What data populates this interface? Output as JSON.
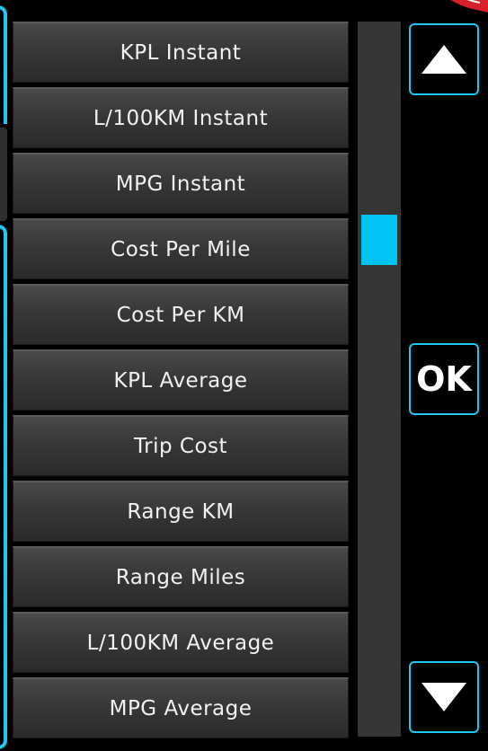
{
  "list": {
    "items": [
      {
        "label": "KPL Instant"
      },
      {
        "label": "L/100KM Instant"
      },
      {
        "label": "MPG Instant"
      },
      {
        "label": "Cost Per Mile"
      },
      {
        "label": "Cost Per KM"
      },
      {
        "label": "KPL Average"
      },
      {
        "label": "Trip Cost"
      },
      {
        "label": "Range KM"
      },
      {
        "label": "Range Miles"
      },
      {
        "label": "L/100KM Average"
      },
      {
        "label": "MPG Average"
      }
    ]
  },
  "scrollbar": {
    "position_fraction": 0.29
  },
  "buttons": {
    "up_icon": "triangle-up-icon",
    "ok_label": "OK",
    "down_icon": "triangle-down-icon"
  },
  "colors": {
    "accent": "#1ec8f2",
    "scroll_thumb": "#00c4f4",
    "item_text": "#f2f2f2",
    "background": "#000000",
    "brand_red": "#d8202a"
  }
}
